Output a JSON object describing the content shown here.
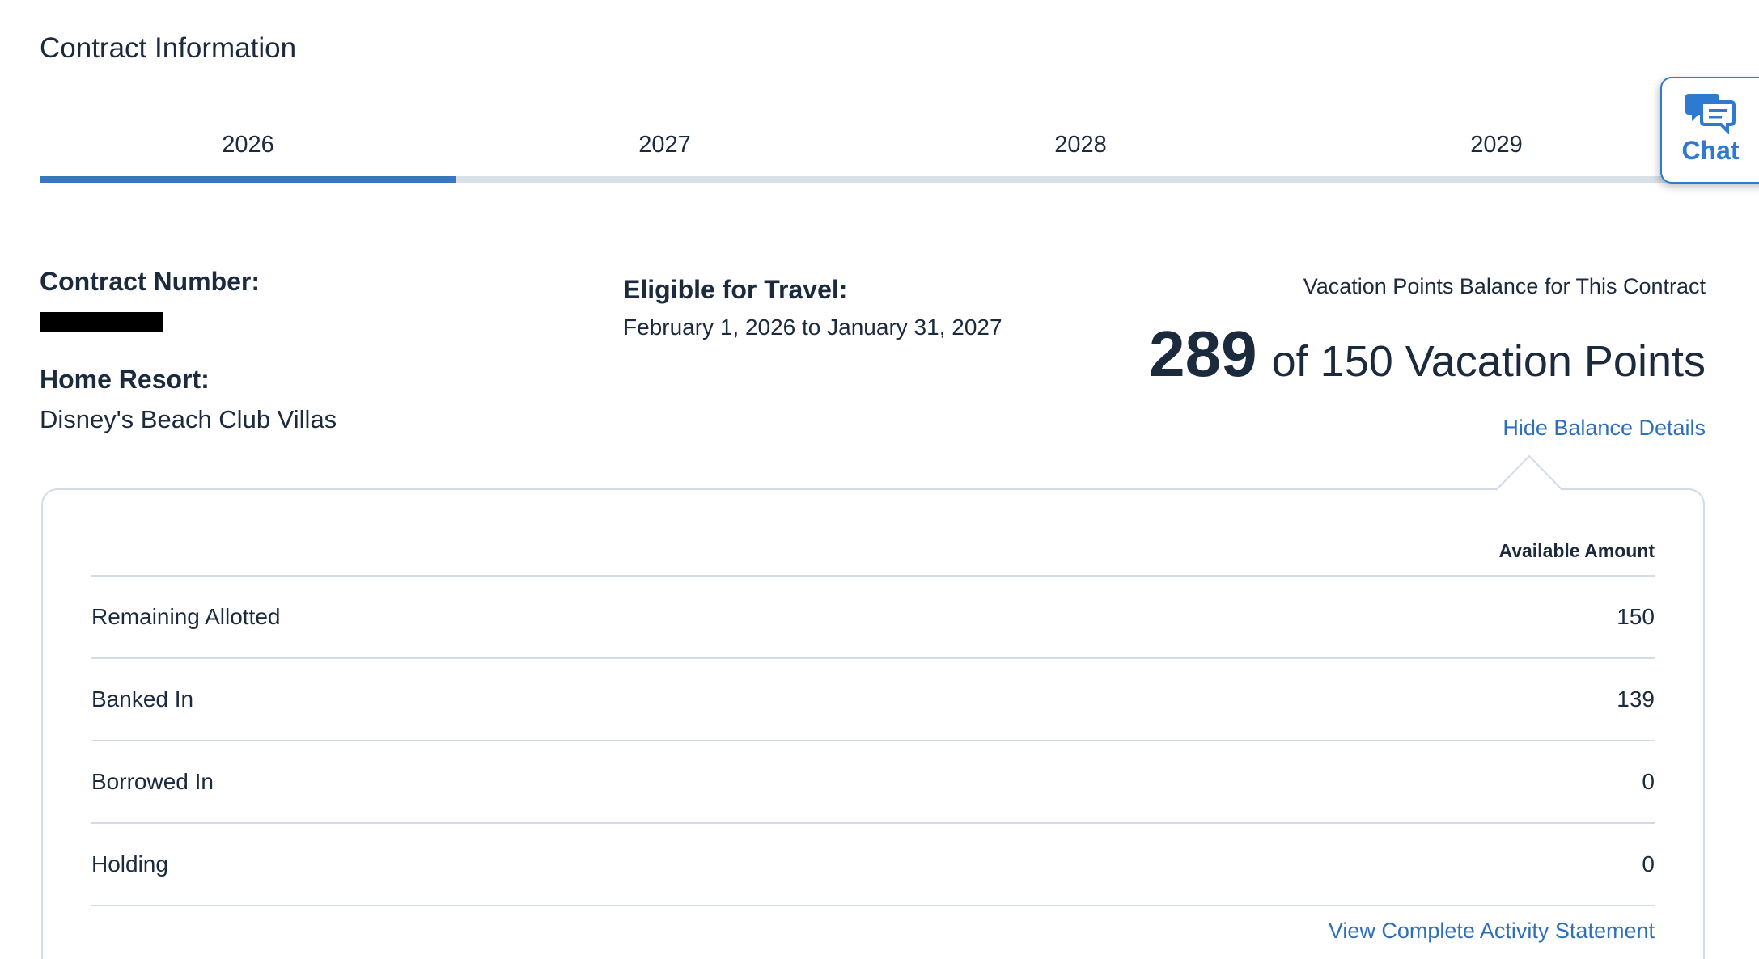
{
  "section_title": "Contract Information",
  "tabs": [
    {
      "label": "2026",
      "selected": true
    },
    {
      "label": "2027",
      "selected": false
    },
    {
      "label": "2028",
      "selected": false
    },
    {
      "label": "2029",
      "selected": false
    }
  ],
  "chat": {
    "label": "Chat",
    "icon": "chat-bubbles-icon"
  },
  "contract": {
    "number_label": "Contract Number:",
    "home_resort_label": "Home Resort:",
    "home_resort_value": "Disney's Beach Club Villas",
    "eligible_label": "Eligible for Travel:",
    "eligible_value": "February 1, 2026 to January 31, 2027"
  },
  "balance": {
    "caption": "Vacation Points Balance for This Contract",
    "current": "289",
    "rest": "of 150 Vacation Points",
    "toggle_link": "Hide Balance Details"
  },
  "details": {
    "column_header": "Available Amount",
    "rows": [
      {
        "label": "Remaining Allotted",
        "value": "150"
      },
      {
        "label": "Banked In",
        "value": "139"
      },
      {
        "label": "Borrowed In",
        "value": "0"
      },
      {
        "label": "Holding",
        "value": "0"
      }
    ],
    "activity_link": "View Complete Activity Statement"
  },
  "colors": {
    "accent": "#3a76c0",
    "link": "#2f6fb8",
    "chat": "#2f7ad1",
    "text": "#1b2a3d",
    "rule": "#d3dbe4"
  }
}
